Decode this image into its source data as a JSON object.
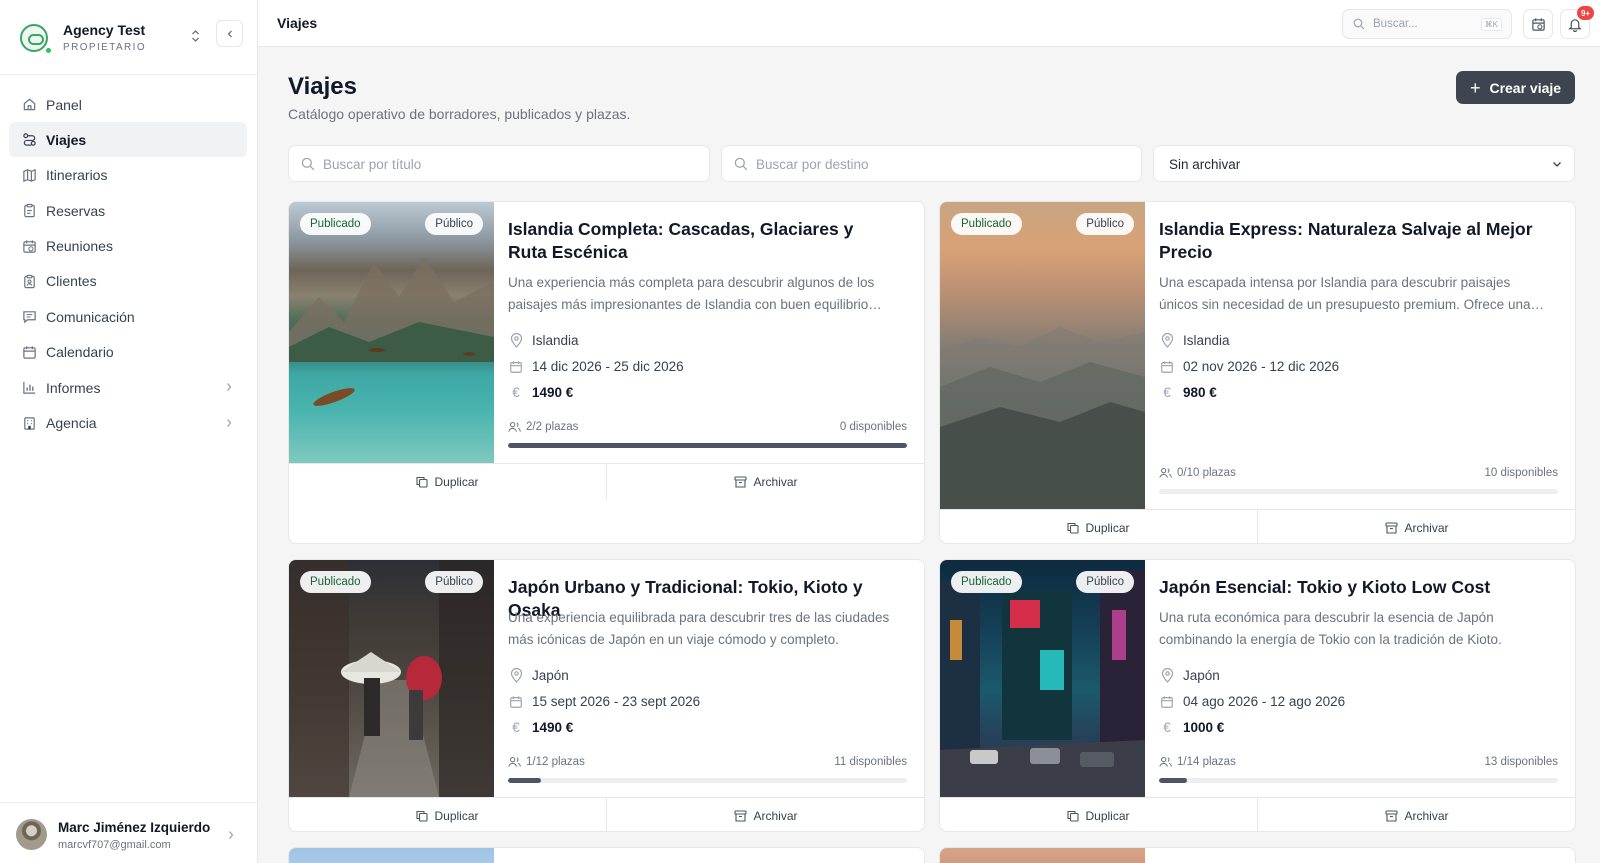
{
  "sidebar": {
    "agency_name": "Agency Test",
    "agency_role": "PROPIETARIO",
    "items": [
      {
        "label": "Panel",
        "icon": "home-icon"
      },
      {
        "label": "Viajes",
        "icon": "route-icon"
      },
      {
        "label": "Itinerarios",
        "icon": "map-icon"
      },
      {
        "label": "Reservas",
        "icon": "clipboard-icon"
      },
      {
        "label": "Reuniones",
        "icon": "calendar-clock-icon"
      },
      {
        "label": "Clientes",
        "icon": "clipboard-user-icon"
      },
      {
        "label": "Comunicación",
        "icon": "message-icon"
      },
      {
        "label": "Calendario",
        "icon": "calendar-icon"
      },
      {
        "label": "Informes",
        "icon": "bar-chart-icon"
      },
      {
        "label": "Agencia",
        "icon": "building-icon"
      }
    ],
    "user_name": "Marc Jiménez Izquierdo",
    "user_email": "marcvf707@gmail.com"
  },
  "topbar": {
    "title": "Viajes",
    "search_placeholder": "Buscar...",
    "search_shortcut": "⌘K",
    "notif_badge": "9+"
  },
  "page": {
    "title": "Viajes",
    "subtitle": "Catálogo operativo de borradores, publicados y plazas.",
    "create_label": "Crear viaje"
  },
  "filters": {
    "title_placeholder": "Buscar por título",
    "destination_placeholder": "Buscar por destino",
    "archive_value": "Sin archivar"
  },
  "cards": [
    {
      "status": "Publicado",
      "visibility": "Público",
      "title": "Islandia Completa: Cascadas, Glaciares y Ruta Escénica",
      "description": "Una experiencia más completa para descubrir algunos de los paisajes más impresionantes de Islandia con buen equilibrio…",
      "destination": "Islandia",
      "dates": "14 dic 2026 - 25 dic 2026",
      "price": "1490 €",
      "seats": "2/2 plazas",
      "available": "0 disponibles",
      "fill": 1.0,
      "duplicate": "Duplicar",
      "archive": "Archivar"
    },
    {
      "status": "Publicado",
      "visibility": "Público",
      "title": "Islandia Express: Naturaleza Salvaje al Mejor Precio",
      "description": "Una escapada intensa por Islandia para descubrir paisajes únicos sin necesidad de un presupuesto premium. Ofrece una…",
      "destination": "Islandia",
      "dates": "02 nov 2026 - 12 dic 2026",
      "price": "980 €",
      "seats": "0/10 plazas",
      "available": "10 disponibles",
      "fill": 0.0,
      "duplicate": "Duplicar",
      "archive": "Archivar"
    },
    {
      "status": "Publicado",
      "visibility": "Público",
      "title": "Japón Urbano y Tradicional: Tokio, Kioto y Osaka",
      "description": "Una experiencia equilibrada para descubrir tres de las ciudades más icónicas de Japón en un viaje cómodo y completo. Combi…",
      "destination": "Japón",
      "dates": "15 sept 2026 - 23 sept 2026",
      "price": "1490 €",
      "seats": "1/12 plazas",
      "available": "11 disponibles",
      "fill": 0.083,
      "duplicate": "Duplicar",
      "archive": "Archivar"
    },
    {
      "status": "Publicado",
      "visibility": "Público",
      "title": "Japón Esencial: Tokio y Kioto Low Cost",
      "description": "Una ruta económica para descubrir la esencia de Japón combinando la energía de Tokio con la tradición de Kioto. Este…",
      "destination": "Japón",
      "dates": "04 ago 2026 - 12 ago 2026",
      "price": "1000 €",
      "seats": "1/14 plazas",
      "available": "13 disponibles",
      "fill": 0.071,
      "duplicate": "Duplicar",
      "archive": "Archivar"
    }
  ]
}
